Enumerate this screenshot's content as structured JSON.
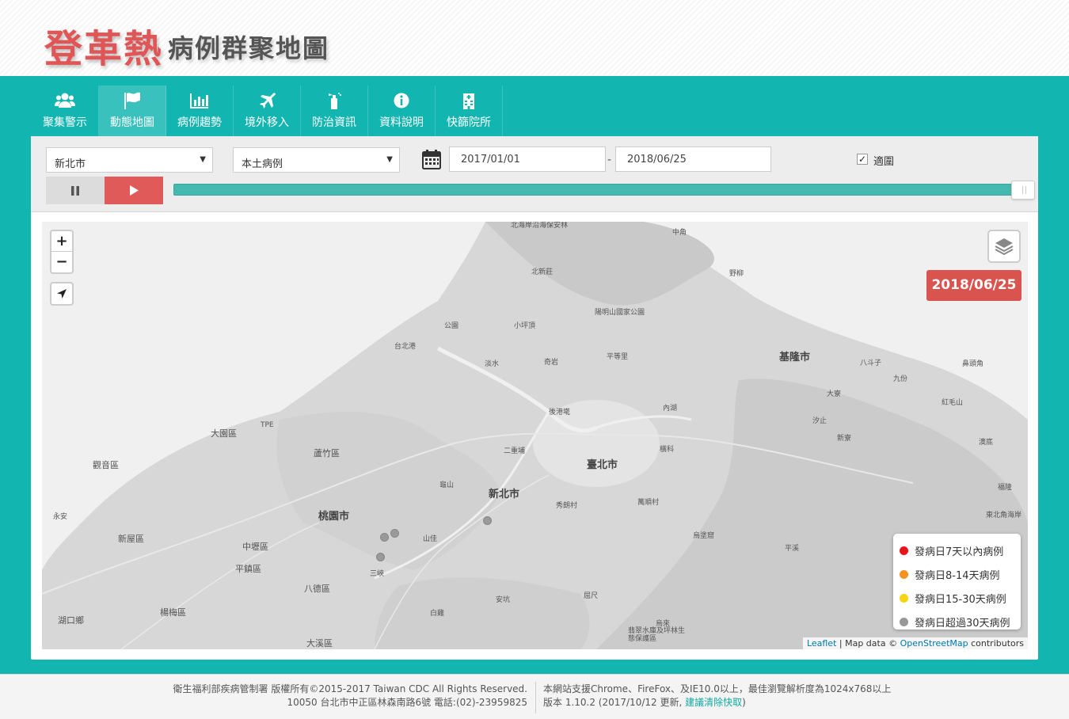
{
  "header": {
    "title_main": "登革熱",
    "title_sub": "病例群聚地圖"
  },
  "nav": {
    "items": [
      {
        "label": "聚集警示",
        "icon": "users-icon"
      },
      {
        "label": "動態地圖",
        "icon": "flag-icon",
        "active": true
      },
      {
        "label": "病例趨勢",
        "icon": "bar-chart-icon"
      },
      {
        "label": "境外移入",
        "icon": "plane-icon"
      },
      {
        "label": "防治資訊",
        "icon": "spray-icon"
      },
      {
        "label": "資料說明",
        "icon": "info-icon"
      },
      {
        "label": "快篩院所",
        "icon": "hospital-icon"
      }
    ]
  },
  "controls": {
    "city_select": "新北市",
    "case_type_select": "本土病例",
    "date_start": "2017/01/01",
    "date_end": "2018/06/25",
    "date_separator": "-",
    "fit_checkbox_label": "適圍",
    "fit_checked": true,
    "timeline_progress": 1.0
  },
  "map": {
    "current_date_badge": "2018/06/25",
    "zoom_in": "+",
    "zoom_out": "−",
    "places_big": [
      "臺北市",
      "新北市",
      "桃園市",
      "基隆市"
    ],
    "places_mid": [
      "大園區",
      "觀音區",
      "蘆竹區",
      "新屋區",
      "中壢區",
      "平鎮區",
      "八德區",
      "楊梅區",
      "湖口鄉",
      "大溪區"
    ],
    "places_small": [
      "北海岸沿海保安林",
      "中角",
      "北新莊",
      "野柳",
      "陽明山國家公園",
      "公園",
      "小坪頂",
      "台北港",
      "淡水",
      "奇岩",
      "平等里",
      "八斗子",
      "鼻頭角",
      "九份",
      "大寮",
      "紅毛山",
      "後港墘",
      "內湖",
      "汐止",
      "新寮",
      "澳底",
      "二重埔",
      "橫科",
      "福隆",
      "龜山",
      "秀朗村",
      "萬順村",
      "東北角海岸",
      "永安",
      "山佳",
      "三峽",
      "烏塗窟",
      "平溪",
      "安坑",
      "白雞",
      "屈尺",
      "烏來",
      "翡翠水庫及坪林生態保護區",
      "TPE"
    ],
    "legend": [
      {
        "label": "發病日7天以內病例",
        "color": "#e8141b"
      },
      {
        "label": "發病日8-14天病例",
        "color": "#f39322"
      },
      {
        "label": "發病日15-30天病例",
        "color": "#f7d40e"
      },
      {
        "label": "發病日超過30天病例",
        "color": "#999999"
      }
    ],
    "attribution": {
      "leaflet": "Leaflet",
      "sep": " | Map data © ",
      "osm": "OpenStreetMap",
      "tail": " contributors"
    }
  },
  "footer": {
    "left_line1": "衛生福利部疾病管制署 版權所有©2015-2017 Taiwan CDC All Rights Reserved.",
    "left_line2": "10050 台北市中正區林森南路6號 電話:(02)-23959825",
    "right_line1": "本網站支援Chrome、FireFox、及IE10.0以上，最佳瀏覽解析度為1024x768以上",
    "right_line2_prefix": "版本 1.10.2 (2017/10/12 更新, ",
    "right_line2_link": "建議清除快取",
    "right_line2_suffix": ")"
  }
}
